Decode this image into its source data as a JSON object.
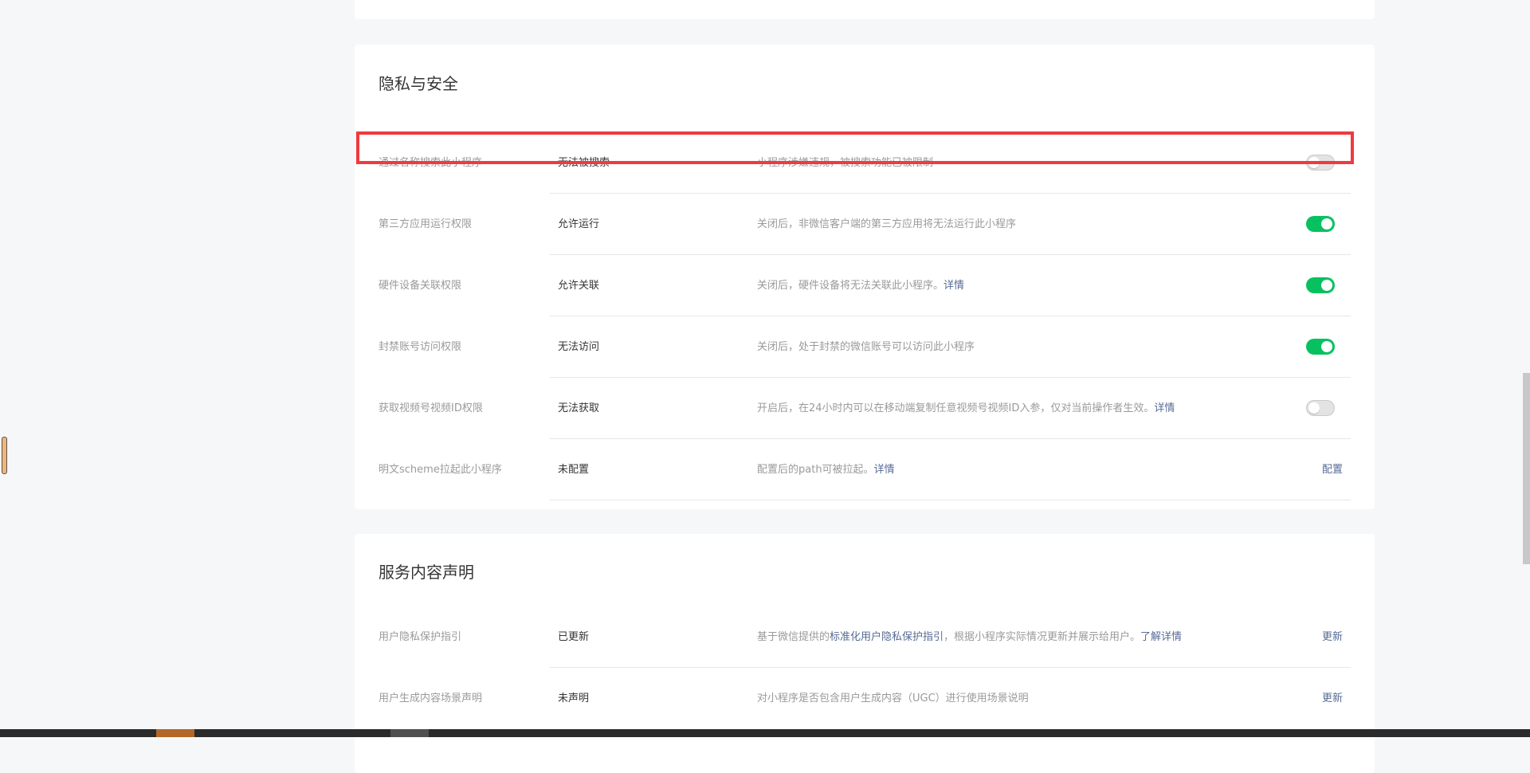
{
  "privacy_section": {
    "title": "隐私与安全",
    "rows": [
      {
        "label": "通过名称搜索此小程序",
        "value": "无法被搜索",
        "desc": "小程序涉嫌违规，被搜索功能已被限制",
        "toggle": "off"
      },
      {
        "label": "第三方应用运行权限",
        "value": "允许运行",
        "desc": "关闭后，非微信客户端的第三方应用将无法运行此小程序",
        "toggle": "on"
      },
      {
        "label": "硬件设备关联权限",
        "value": "允许关联",
        "desc": "关闭后，硬件设备将无法关联此小程序。",
        "link": "详情",
        "toggle": "on"
      },
      {
        "label": "封禁账号访问权限",
        "value": "无法访问",
        "desc": "关闭后，处于封禁的微信账号可以访问此小程序",
        "toggle": "on"
      },
      {
        "label": "获取视频号视频ID权限",
        "value": "无法获取",
        "desc": "开启后，在24小时内可以在移动端复制任意视频号视频ID入参，仅对当前操作者生效。",
        "link": "详情",
        "toggle": "off"
      },
      {
        "label": "明文scheme拉起此小程序",
        "value": "未配置",
        "desc": "配置后的path可被拉起。",
        "link": "详情",
        "action": "配置"
      }
    ]
  },
  "service_section": {
    "title": "服务内容声明",
    "rows": [
      {
        "label": "用户隐私保护指引",
        "value": "已更新",
        "desc_prefix": "基于微信提供的",
        "desc_link": "标准化用户隐私保护指引",
        "desc_suffix": "，根据小程序实际情况更新并展示给用户。",
        "link": "了解详情",
        "action": "更新"
      },
      {
        "label": "用户生成内容场景声明",
        "value": "未声明",
        "desc": "对小程序是否包含用户生成内容（UGC）进行使用场景说明",
        "action": "更新"
      }
    ]
  },
  "colors": {
    "toggle_on": "#07c160",
    "link": "#576b95",
    "highlight": "#ef3a3f"
  }
}
